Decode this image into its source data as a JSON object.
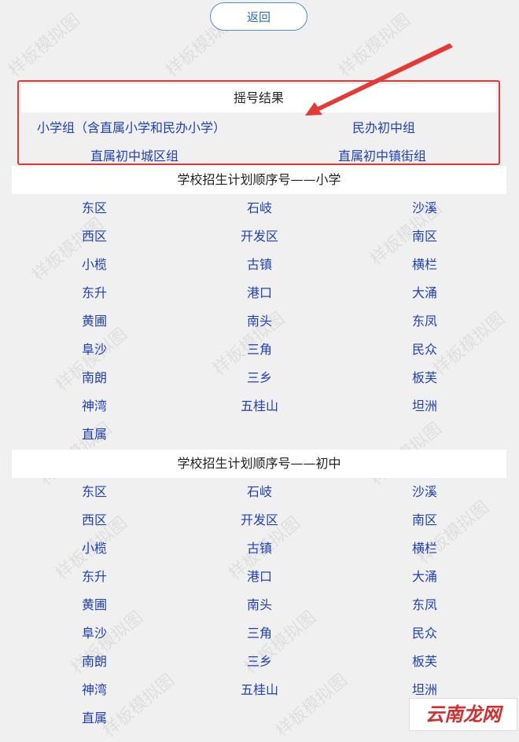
{
  "back_label": "返回",
  "result": {
    "title": "摇号结果",
    "links": [
      "小学组（含直属小学和民办小学）",
      "民办初中组",
      "直属初中城区组",
      "直属初中镇街组"
    ]
  },
  "primary": {
    "title": "学校招生计划顺序号——小学",
    "rows": [
      [
        "东区",
        "石岐",
        "沙溪"
      ],
      [
        "西区",
        "开发区",
        "南区"
      ],
      [
        "小榄",
        "古镇",
        "横栏"
      ],
      [
        "东升",
        "港口",
        "大涌"
      ],
      [
        "黄圃",
        "南头",
        "东凤"
      ],
      [
        "阜沙",
        "三角",
        "民众"
      ],
      [
        "南朗",
        "三乡",
        "板芙"
      ],
      [
        "神湾",
        "五桂山",
        "坦洲"
      ],
      [
        "直属",
        "",
        ""
      ]
    ]
  },
  "junior": {
    "title": "学校招生计划顺序号——初中",
    "rows": [
      [
        "东区",
        "石岐",
        "沙溪"
      ],
      [
        "西区",
        "开发区",
        "南区"
      ],
      [
        "小榄",
        "古镇",
        "横栏"
      ],
      [
        "东升",
        "港口",
        "大涌"
      ],
      [
        "黄圃",
        "南头",
        "东凤"
      ],
      [
        "阜沙",
        "三角",
        "民众"
      ],
      [
        "南朗",
        "三乡",
        "板芙"
      ],
      [
        "神湾",
        "五桂山",
        "坦洲"
      ],
      [
        "直属",
        "",
        ""
      ]
    ]
  },
  "watermark": "样板模拟图",
  "logo_text": "云南龙网",
  "colors": {
    "link": "#1e3fbf",
    "highlight_border": "#e53935",
    "button_border": "#4a90d9"
  }
}
